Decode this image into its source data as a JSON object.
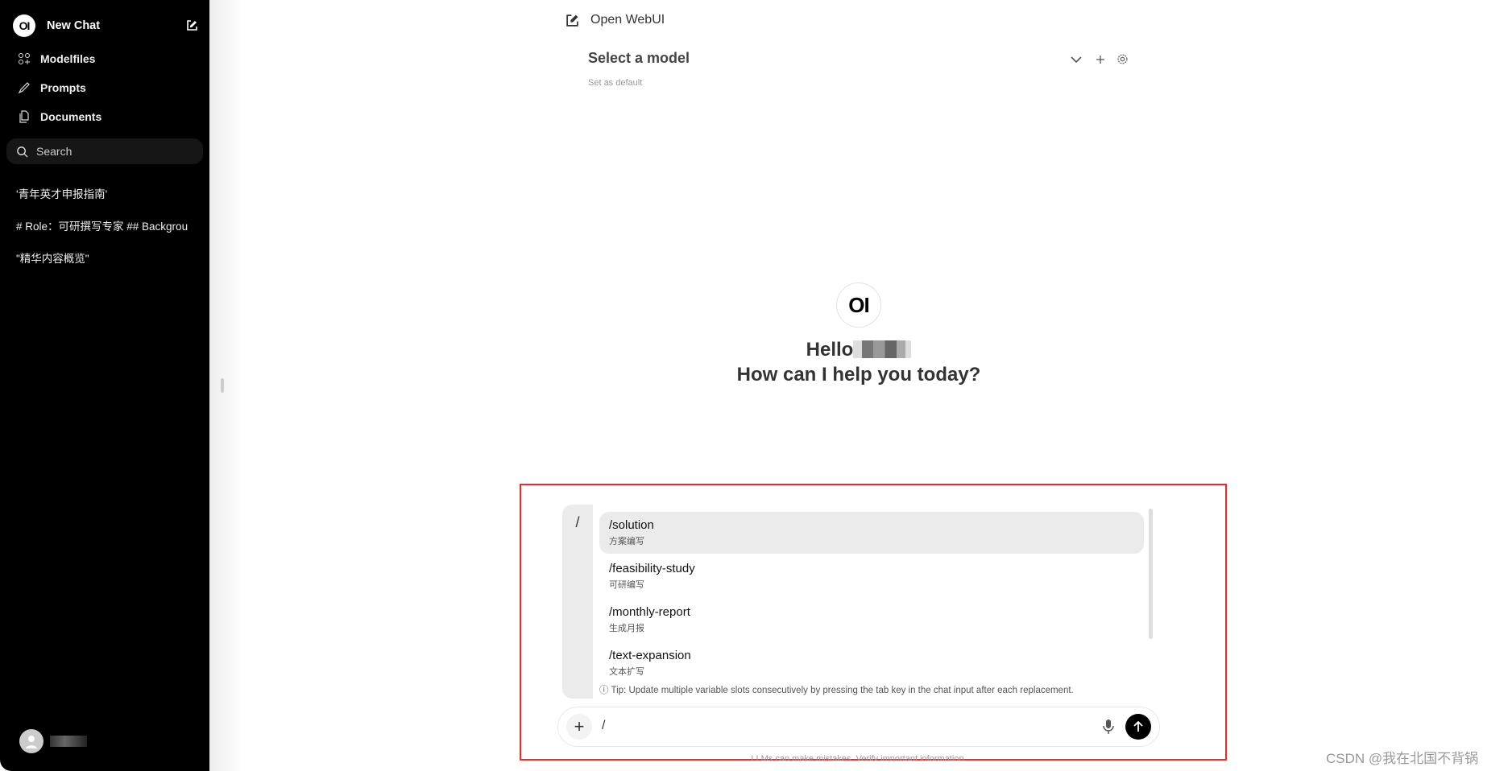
{
  "sidebar": {
    "new_chat": "New Chat",
    "logo_text": "OI",
    "items": [
      {
        "label": "Modelfiles",
        "icon": "modelfiles-icon"
      },
      {
        "label": "Prompts",
        "icon": "pencil-icon"
      },
      {
        "label": "Documents",
        "icon": "documents-icon"
      }
    ],
    "search_placeholder": "Search",
    "history": [
      "'青年英才申报指南'",
      "# Role：可研撰写专家 ## Backgrou",
      "\"精华内容概览\""
    ]
  },
  "header": {
    "title": "Open WebUI",
    "model_select": "Select a model",
    "set_default": "Set as default"
  },
  "welcome": {
    "logo_text": "OI",
    "hello": "Hello",
    "question": "How can I help you today?"
  },
  "prompts": {
    "trigger": "/",
    "items": [
      {
        "command": "/solution",
        "description": "方案编写",
        "selected": true
      },
      {
        "command": "/feasibility-study",
        "description": "可研编写"
      },
      {
        "command": "/monthly-report",
        "description": "生成月报"
      },
      {
        "command": "/text-expansion",
        "description": "文本扩写"
      }
    ],
    "tip": "Tip: Update multiple variable slots consecutively by pressing the tab key in the chat input after each replacement."
  },
  "input": {
    "value": "/"
  },
  "footer": "LLMs can make mistakes. Verify important information.",
  "watermark": "CSDN @我在北国不背锅",
  "colors": {
    "highlight_box": "#ff2222",
    "sidebar_bg": "#000000",
    "selected_item": "#ebebeb"
  }
}
